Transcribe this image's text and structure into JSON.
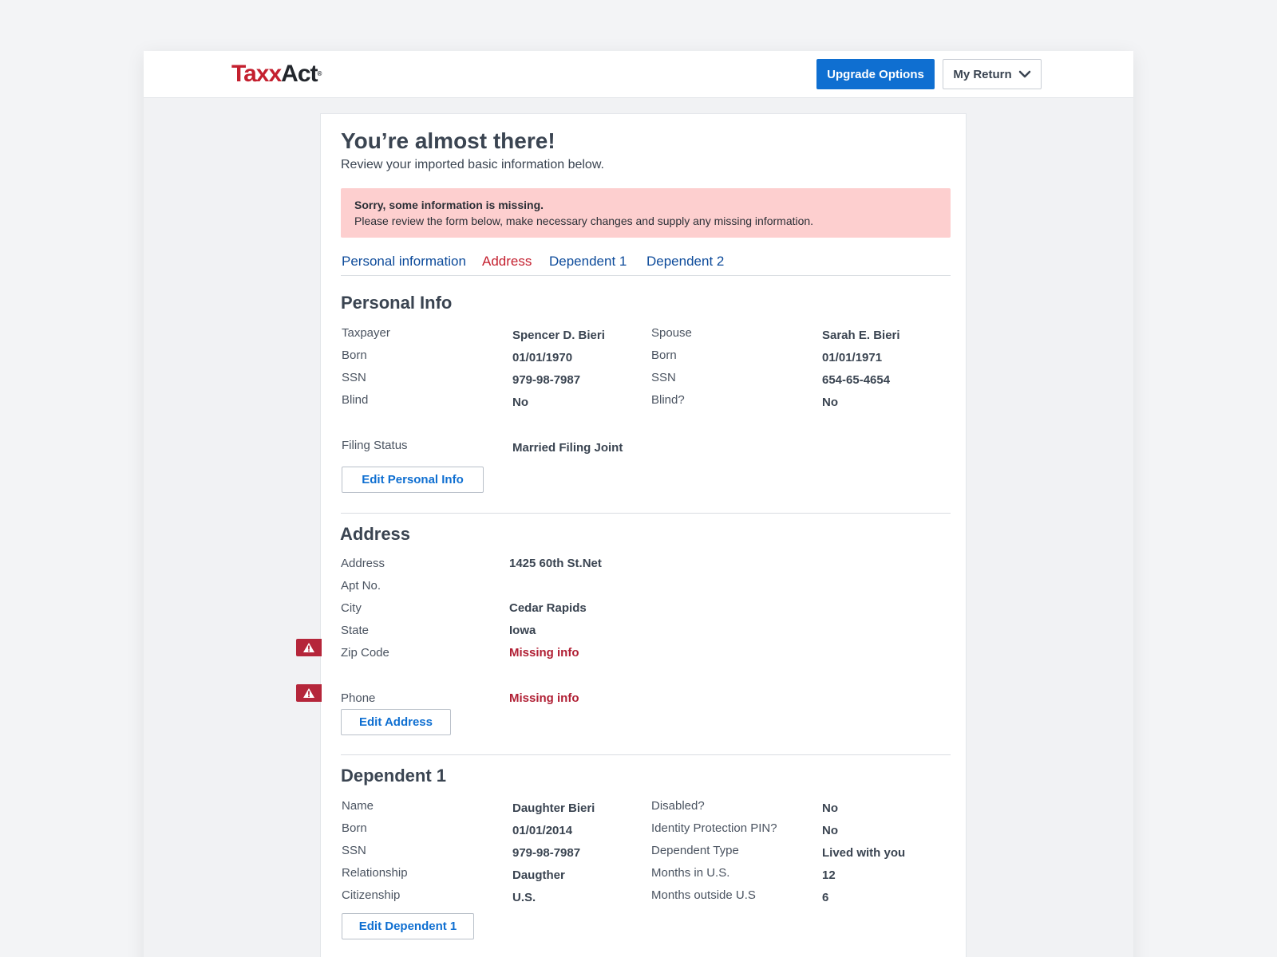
{
  "header": {
    "logo_part1": "Tax",
    "logo_x": "x",
    "logo_part2": "Act",
    "logo_reg": "®",
    "upgrade_label": "Upgrade Options",
    "my_return_label": "My Return"
  },
  "intro": {
    "title": "You’re almost there!",
    "subtitle": "Review your imported basic information below."
  },
  "alert": {
    "title": "Sorry, some information is missing.",
    "message": "Please review the form below, make necessary changes and supply any missing information."
  },
  "tabs": [
    {
      "label": "Personal information",
      "has_error": false
    },
    {
      "label": "Address",
      "has_error": true
    },
    {
      "label": "Dependent 1",
      "has_error": false
    },
    {
      "label": "Dependent 2",
      "has_error": false
    }
  ],
  "personal": {
    "heading": "Personal Info",
    "taxpayer": {
      "labels": [
        "Taxpayer",
        "Born",
        "SSN",
        "Blind"
      ],
      "values": [
        "Spencer D. Bieri",
        "01/01/1970",
        "979-98-7987",
        "No"
      ]
    },
    "spouse": {
      "labels": [
        "Spouse",
        "Born",
        "SSN",
        "Blind?"
      ],
      "values": [
        "Sarah E. Bieri",
        "01/01/1971",
        "654-65-4654",
        "No"
      ]
    },
    "filing_status_label": "Filing Status",
    "filing_status_value": "Married Filing Joint",
    "edit_label": "Edit Personal Info"
  },
  "address": {
    "heading": "Address",
    "fields": [
      {
        "label": "Address",
        "value": "1425 60th St.Net",
        "missing": false
      },
      {
        "label": "Apt No.",
        "value": "",
        "missing": false
      },
      {
        "label": "City",
        "value": "Cedar Rapids",
        "missing": false
      },
      {
        "label": "State",
        "value": "Iowa",
        "missing": false
      },
      {
        "label": "Zip Code",
        "value": "Missing info",
        "missing": true
      }
    ],
    "phone": {
      "label": "Phone",
      "value": "Missing info",
      "missing": true
    },
    "edit_label": "Edit Address"
  },
  "dependent1": {
    "heading": "Dependent 1",
    "left": {
      "labels": [
        "Name",
        "Born",
        "SSN",
        "Relationship",
        "Citizenship"
      ],
      "values": [
        "Daughter Bieri",
        "01/01/2014",
        "979-98-7987",
        "Daugther",
        "U.S."
      ]
    },
    "right": {
      "labels": [
        "Disabled?",
        "Identity Protection PIN?",
        "Dependent Type",
        "Months in U.S.",
        "Months outside U.S"
      ],
      "values": [
        "No",
        "No",
        "Lived with you",
        "12",
        "6"
      ]
    },
    "edit_label": "Edit Dependent 1"
  },
  "colors": {
    "primary_blue": "#0f6fd1",
    "tab_blue": "#0c4a9a",
    "error_red": "#b01f34",
    "alert_bg": "#fdcfcf",
    "brand_red": "#c4202f"
  }
}
